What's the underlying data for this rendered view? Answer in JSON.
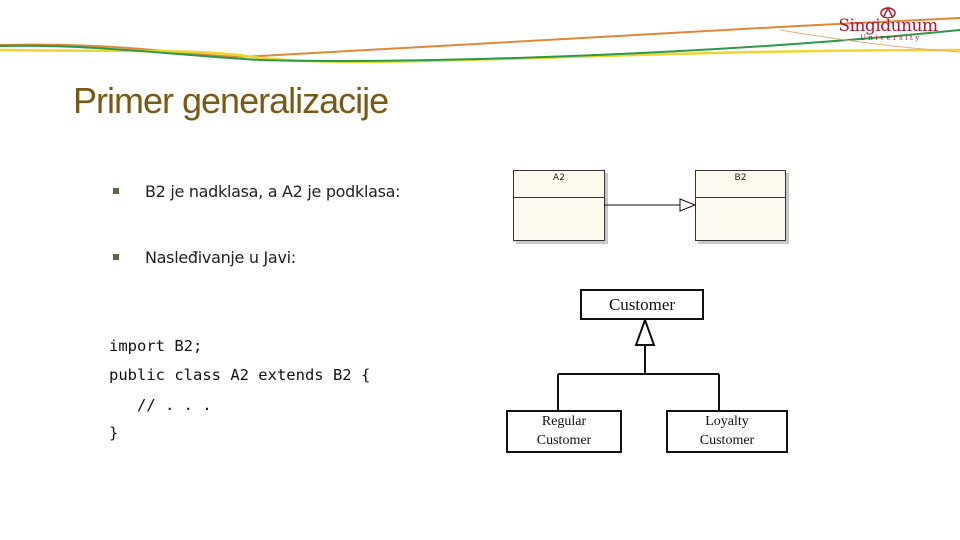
{
  "slide": {
    "title": "Primer generalizacije",
    "logo": {
      "name": "Singidunum",
      "subtitle": "University"
    },
    "bullets": [
      "B2 je nadklasa, a A2 je podklasa:",
      "Nasleđivanje u Javi:"
    ],
    "code_lines": [
      "import B2;",
      "public class A2 extends B2 {",
      "   // . . .",
      "}"
    ]
  },
  "diagram_top": {
    "subclass": "A2",
    "superclass": "B2",
    "relation": "generalization"
  },
  "diagram_bottom": {
    "parent": "Customer",
    "children": [
      {
        "line1": "Regular",
        "line2": "Customer"
      },
      {
        "line1": "Loyalty",
        "line2": "Customer"
      }
    ],
    "relation": "generalization"
  }
}
